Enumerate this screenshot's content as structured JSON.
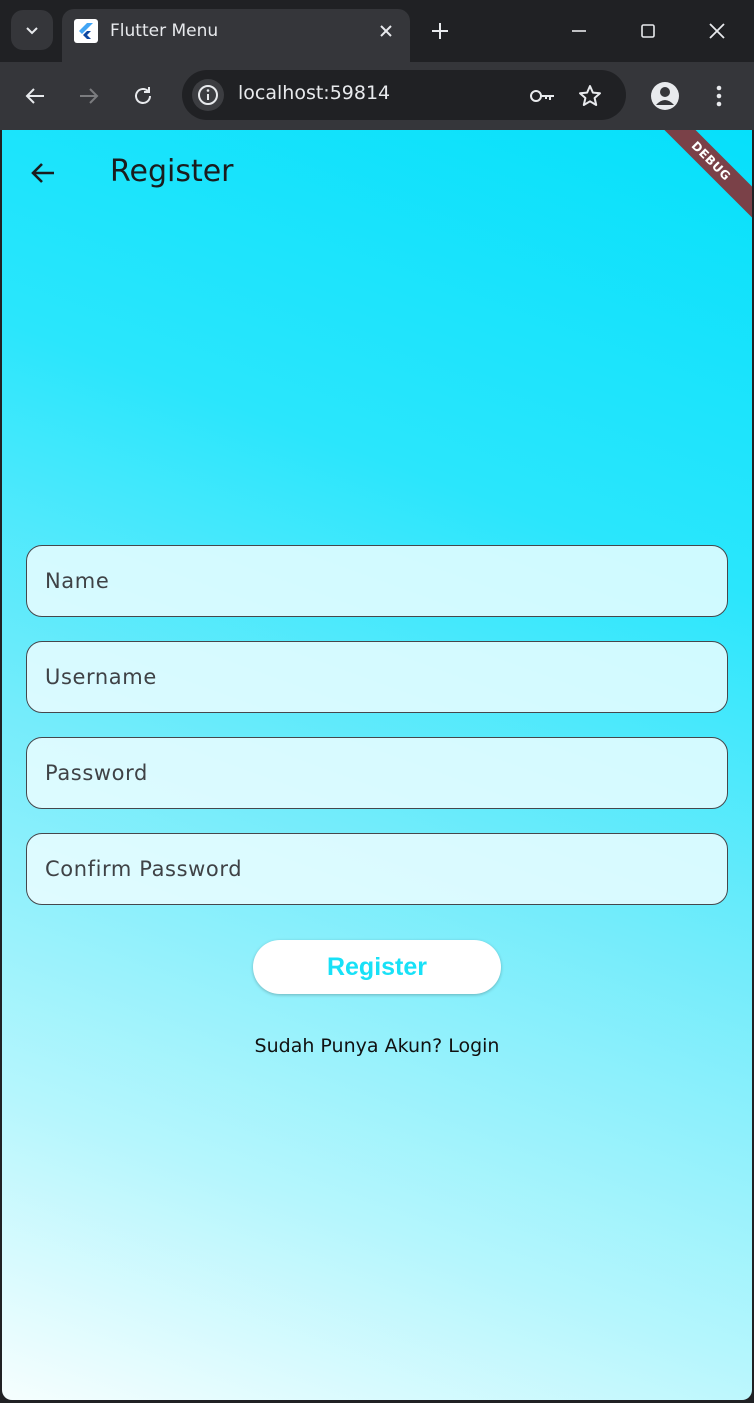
{
  "browser": {
    "tab_title": "Flutter Menu",
    "url": "localhost:59814"
  },
  "app": {
    "debug_label": "DEBUG",
    "title": "Register",
    "fields": [
      {
        "placeholder": "Name"
      },
      {
        "placeholder": "Username"
      },
      {
        "placeholder": "Password"
      },
      {
        "placeholder": "Confirm Password"
      }
    ],
    "register_label": "Register",
    "login_prompt": "Sudah Punya Akun? Login",
    "colors": {
      "accent": "#18e1f7",
      "gradient_top": "#06e0fb",
      "gradient_bottom": "#f6fefe"
    }
  }
}
